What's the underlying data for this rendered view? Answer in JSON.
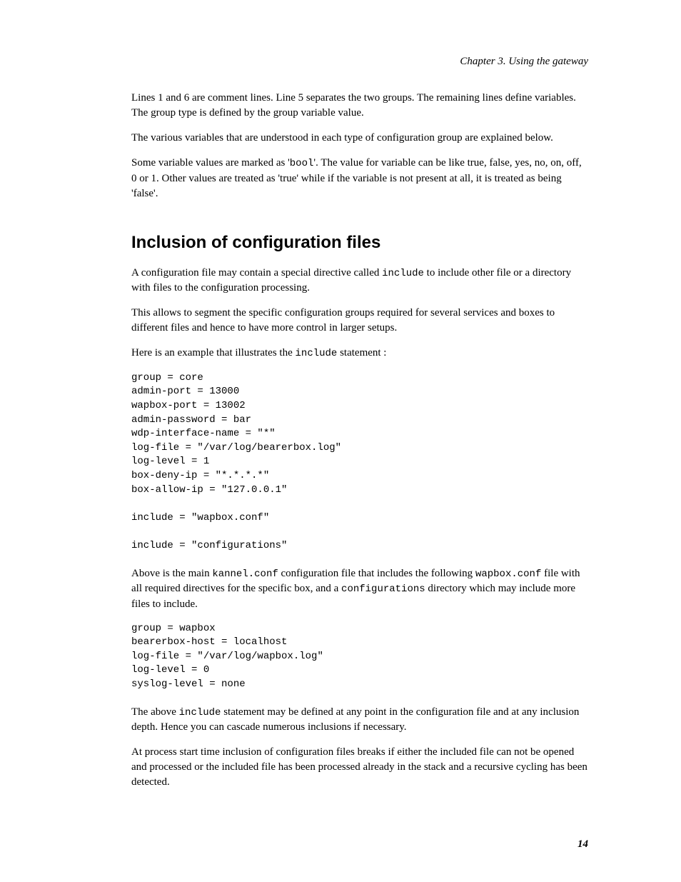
{
  "chapterHeader": "Chapter 3. Using the gateway",
  "para1": "Lines 1 and 6 are comment lines. Line 5 separates the two groups. The remaining lines define variables. The group type is defined by the group variable value.",
  "para2": "The various variables that are understood in each type of configuration group are explained below.",
  "para3_pre": "Some variable values are marked as '",
  "para3_code": "bool",
  "para3_post": "'. The value for variable can be like true, false, yes, no, on, off, 0 or 1. Other values are treated as 'true' while if the variable is not present at all, it is treated as being 'false'.",
  "sectionTitle": "Inclusion of configuration files",
  "para4_pre": "A configuration file may contain a special directive called ",
  "para4_code": "include",
  "para4_post": " to include other file or a directory with files to the configuration processing.",
  "para5": "This allows to segment the specific configuration groups required for several services and boxes to different files and hence to have more control in larger setups.",
  "para6_pre": "Here is an example that illustrates the ",
  "para6_code": "include",
  "para6_post": "  statement :",
  "codeBlock1": "group = core\nadmin-port = 13000\nwapbox-port = 13002\nadmin-password = bar\nwdp-interface-name = \"*\"\nlog-file = \"/var/log/bearerbox.log\"\nlog-level = 1\nbox-deny-ip = \"*.*.*.*\"\nbox-allow-ip = \"127.0.0.1\"\n\ninclude = \"wapbox.conf\"\n\ninclude = \"configurations\"",
  "para7_a": "Above is the main ",
  "para7_code1": "kannel.conf",
  "para7_b": " configuration file that includes the following ",
  "para7_code2": "wapbox.conf",
  "para7_c": " file with all required directives for the specific box, and a ",
  "para7_code3": "configurations",
  "para7_d": " directory which may include more files to include.",
  "codeBlock2": "group = wapbox\nbearerbox-host = localhost\nlog-file = \"/var/log/wapbox.log\"\nlog-level = 0\nsyslog-level = none",
  "para8_a": "The above ",
  "para8_code": "include",
  "para8_b": " statement may be defined at any point in the configuration file and at any inclusion depth. Hence you can cascade numerous inclusions if necessary.",
  "para9": "At process start time inclusion of configuration files breaks if either the included file can not be opened and processed or the included file has been processed already in the stack and a recursive cycling has been detected.",
  "pageNumber": "14"
}
